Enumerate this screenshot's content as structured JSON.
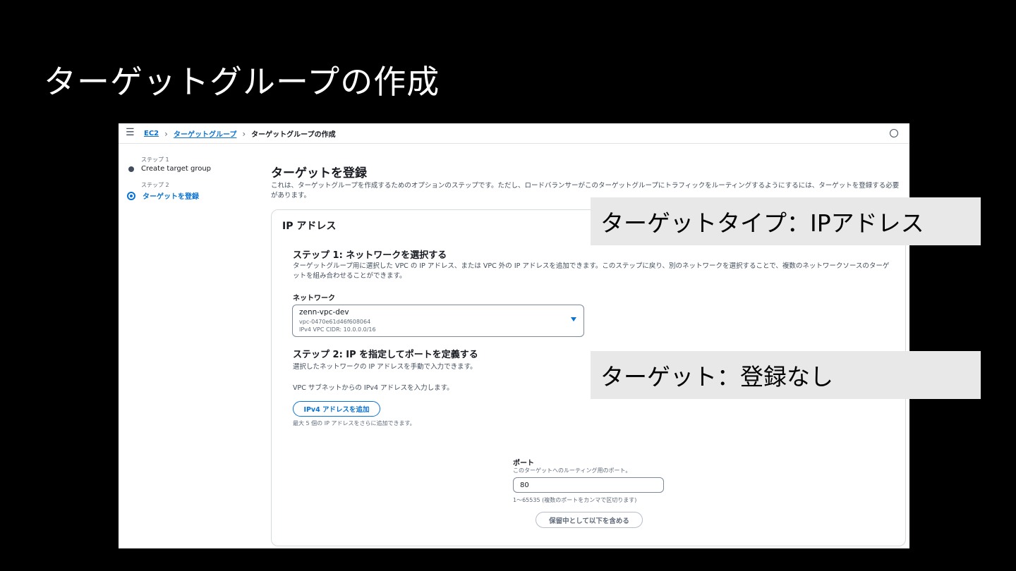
{
  "slide": {
    "title": "ターゲットグループの作成"
  },
  "topbar": {
    "breadcrumbs": {
      "ec2": "EC2",
      "target_groups": "ターゲットグループ",
      "current": "ターゲットグループの作成"
    },
    "icons": {
      "menu": "hamburger-menu-icon",
      "settings": "clock-icon"
    }
  },
  "steps": [
    {
      "caption": "ステップ 1",
      "label": "Create target group"
    },
    {
      "caption": "ステップ 2",
      "label": "ターゲットを登録"
    }
  ],
  "main": {
    "title": "ターゲットを登録",
    "description": "これは、ターゲットグループを作成するためのオプションのステップです。ただし、ロードバランサーがこのターゲットグループにトラフィックをルーティングするようにするには、ターゲットを登録する必要があります。"
  },
  "panel": {
    "title": "IP アドレス",
    "step1": {
      "title": "ステップ 1: ネットワークを選択する",
      "description": "ターゲットグループ用に選択した VPC の IP アドレス、または VPC 外の IP アドレスを追加できます。このステップに戻り、別のネットワークを選択することで、複数のネットワークソースのターゲットを組み合わせることができます。",
      "network_label": "ネットワーク",
      "network": {
        "name": "zenn-vpc-dev",
        "id": "vpc-0470e61d46f608064",
        "cidr": "IPv4 VPC CIDR: 10.0.0.0/16"
      }
    },
    "step2": {
      "title": "ステップ 2: IP を指定してポートを定義する",
      "description": "選択したネットワークの IP アドレスを手動で入力できます。",
      "hint": "VPC サブネットからの IPv4 アドレスを入力します。",
      "add_button": "IPv4 アドレスを追加",
      "add_note": "最大 5 個の IP アドレスをさらに追加できます。"
    },
    "port": {
      "label": "ポート",
      "description": "このターゲットへのルーティング用のポート。",
      "value": "80",
      "range": "1〜65535 (複数のポートをカンマで区切ります)",
      "include_button": "保留中として以下を含める"
    }
  },
  "callouts": {
    "target_type": "ターゲットタイプ：IPアドレス",
    "targets": "ターゲット：登録なし"
  }
}
